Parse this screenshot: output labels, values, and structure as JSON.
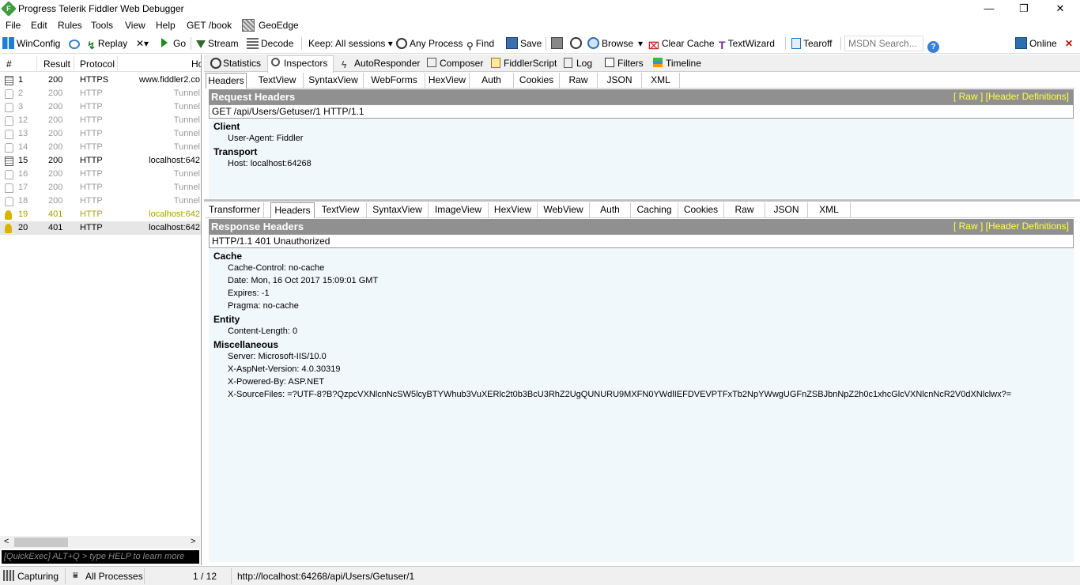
{
  "window": {
    "title": "Progress Telerik Fiddler Web Debugger",
    "minimize": "—",
    "maximize": "❐",
    "close": "✕"
  },
  "menu": [
    "File",
    "Edit",
    "Rules",
    "Tools",
    "View",
    "Help",
    "GET /book",
    "GeoEdge"
  ],
  "toolbar": {
    "winconfig": "WinConfig",
    "replay": "Replay",
    "remove": "✕▾",
    "go": "Go",
    "stream": "Stream",
    "decode": "Decode",
    "keep": "Keep: All sessions ▾",
    "any_process": "Any Process",
    "find": "Find",
    "save": "Save",
    "browse": "Browse",
    "browse_arrow": "▾",
    "clear_cache": "Clear Cache",
    "textwizard": "TextWizard",
    "tearoff": "Tearoff",
    "msdn_placeholder": "MSDN Search...",
    "online": "Online",
    "close": "✕"
  },
  "sessions": {
    "headers": {
      "num": "#",
      "result": "Result",
      "protocol": "Protocol",
      "host": "Ho"
    },
    "rows": [
      {
        "num": "1",
        "result": "200",
        "protocol": "HTTPS",
        "host": "www.fiddler2.co",
        "style": "normal"
      },
      {
        "num": "2",
        "result": "200",
        "protocol": "HTTP",
        "host": "Tunnel",
        "style": "dim"
      },
      {
        "num": "3",
        "result": "200",
        "protocol": "HTTP",
        "host": "Tunnel",
        "style": "dim"
      },
      {
        "num": "12",
        "result": "200",
        "protocol": "HTTP",
        "host": "Tunnel",
        "style": "dim"
      },
      {
        "num": "13",
        "result": "200",
        "protocol": "HTTP",
        "host": "Tunnel",
        "style": "dim"
      },
      {
        "num": "14",
        "result": "200",
        "protocol": "HTTP",
        "host": "Tunnel",
        "style": "dim"
      },
      {
        "num": "15",
        "result": "200",
        "protocol": "HTTP",
        "host": "localhost:642",
        "style": "normal"
      },
      {
        "num": "16",
        "result": "200",
        "protocol": "HTTP",
        "host": "Tunnel",
        "style": "dim"
      },
      {
        "num": "17",
        "result": "200",
        "protocol": "HTTP",
        "host": "Tunnel",
        "style": "dim"
      },
      {
        "num": "18",
        "result": "200",
        "protocol": "HTTP",
        "host": "Tunnel",
        "style": "dim"
      },
      {
        "num": "19",
        "result": "401",
        "protocol": "HTTP",
        "host": "localhost:642",
        "style": "warn"
      },
      {
        "num": "20",
        "result": "401",
        "protocol": "HTTP",
        "host": "localhost:642",
        "style": "sel"
      }
    ],
    "scroll_left": "<",
    "scroll_right": ">",
    "quickexec": "[QuickExec] ALT+Q > type HELP to learn more"
  },
  "top_tabs": [
    "Statistics",
    "Inspectors",
    "AutoResponder",
    "Composer",
    "FiddlerScript",
    "Log",
    "Filters",
    "Timeline"
  ],
  "request": {
    "tabs": [
      "Headers",
      "TextView",
      "SyntaxView",
      "WebForms",
      "HexView",
      "Auth",
      "Cookies",
      "Raw",
      "JSON",
      "XML"
    ],
    "title": "Request Headers",
    "links": "[ Raw ]   [Header Definitions]",
    "line": "GET /api/Users/Getuser/1 HTTP/1.1",
    "groups": [
      {
        "name": "Client",
        "headers": [
          "User-Agent: Fiddler"
        ]
      },
      {
        "name": "Transport",
        "headers": [
          "Host: localhost:64268"
        ]
      }
    ]
  },
  "response": {
    "tabs": [
      "Transformer",
      "Headers",
      "TextView",
      "SyntaxView",
      "ImageView",
      "HexView",
      "WebView",
      "Auth",
      "Caching",
      "Cookies",
      "Raw",
      "JSON",
      "XML"
    ],
    "title": "Response Headers",
    "links": "[ Raw ]   [Header Definitions]",
    "line": "HTTP/1.1 401 Unauthorized",
    "groups": [
      {
        "name": "Cache",
        "headers": [
          "Cache-Control: no-cache",
          "Date: Mon, 16 Oct 2017 15:09:01 GMT",
          "Expires: -1",
          "Pragma: no-cache"
        ]
      },
      {
        "name": "Entity",
        "headers": [
          "Content-Length: 0"
        ]
      },
      {
        "name": "Miscellaneous",
        "headers": [
          "Server: Microsoft-IIS/10.0",
          "X-AspNet-Version: 4.0.30319",
          "X-Powered-By: ASP.NET",
          "X-SourceFiles: =?UTF-8?B?QzpcVXNlcnNcSW5lcyBTYWhub3VuXERlc2t0b3BcU3RhZ2UgQUNURU9MXFN0YWdlIEFDVEVPTFxTb2NpYWwgUGFnZSBJbnNpZ2h0c1xhcGlcVXNlcnNcR2V0dXNlclwx?="
        ]
      }
    ]
  },
  "status": {
    "capturing": "Capturing",
    "processes": "All Processes",
    "count": "1 / 12",
    "url": "http://localhost:64268/api/Users/Getuser/1"
  },
  "colors": {
    "panel_bg": "#f0f8fb",
    "header_bar": "#909090",
    "link_yellow": "#ffff40",
    "warn_text": "#a8a000"
  }
}
